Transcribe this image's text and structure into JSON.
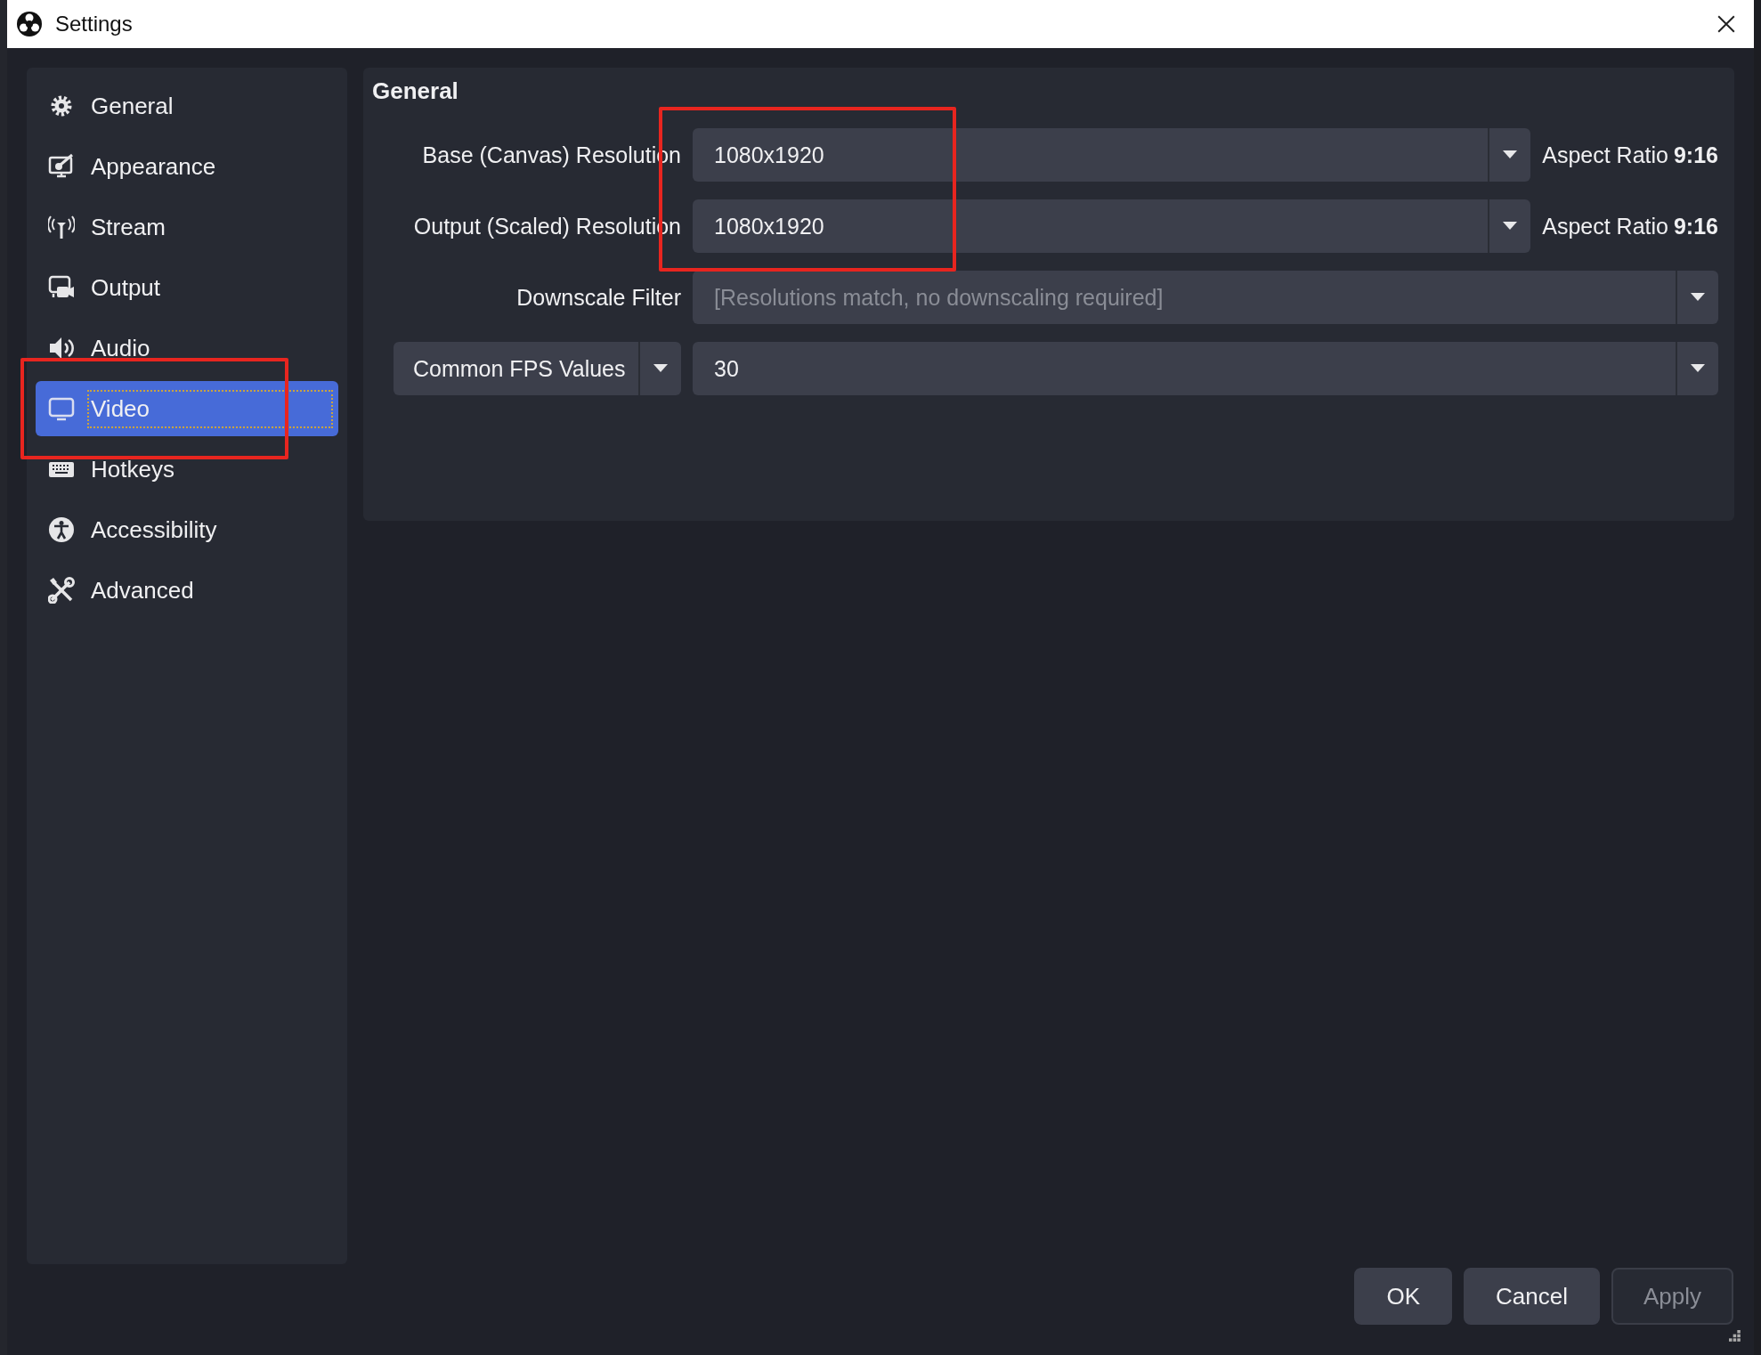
{
  "window": {
    "title": "Settings"
  },
  "sidebar": {
    "items": [
      {
        "label": "General",
        "kind": "gear",
        "selected": false
      },
      {
        "label": "Appearance",
        "kind": "appearance",
        "selected": false
      },
      {
        "label": "Stream",
        "kind": "antenna",
        "selected": false
      },
      {
        "label": "Output",
        "kind": "output",
        "selected": false
      },
      {
        "label": "Audio",
        "kind": "speaker",
        "selected": false
      },
      {
        "label": "Video",
        "kind": "monitor",
        "selected": true
      },
      {
        "label": "Hotkeys",
        "kind": "keyboard",
        "selected": false
      },
      {
        "label": "Accessibility",
        "kind": "accessibility",
        "selected": false
      },
      {
        "label": "Advanced",
        "kind": "tools",
        "selected": false
      }
    ]
  },
  "section": {
    "title": "General",
    "rows": [
      {
        "kind": "resolution",
        "label": "Base (Canvas) Resolution",
        "value": "1080x1920",
        "aspect": "Aspect Ratio **9:16**",
        "disabled": false
      },
      {
        "kind": "resolution",
        "label": "Output (Scaled) Resolution",
        "value": "1080x1920",
        "aspect": "Aspect Ratio **9:16**",
        "disabled": false
      },
      {
        "kind": "filter",
        "label": "Downscale Filter",
        "value": "[Resolutions match, no downscaling required]",
        "disabled": true
      },
      {
        "kind": "fps",
        "selector": "Common FPS Values",
        "value": "30",
        "disabled": false
      }
    ]
  },
  "buttons": [
    {
      "label": "OK",
      "disabled": false
    },
    {
      "label": "Cancel",
      "disabled": false
    },
    {
      "label": "Apply",
      "disabled": true
    }
  ],
  "annotations": [
    {
      "kind": "highlight-box"
    },
    {
      "kind": "highlight-box"
    }
  ]
}
